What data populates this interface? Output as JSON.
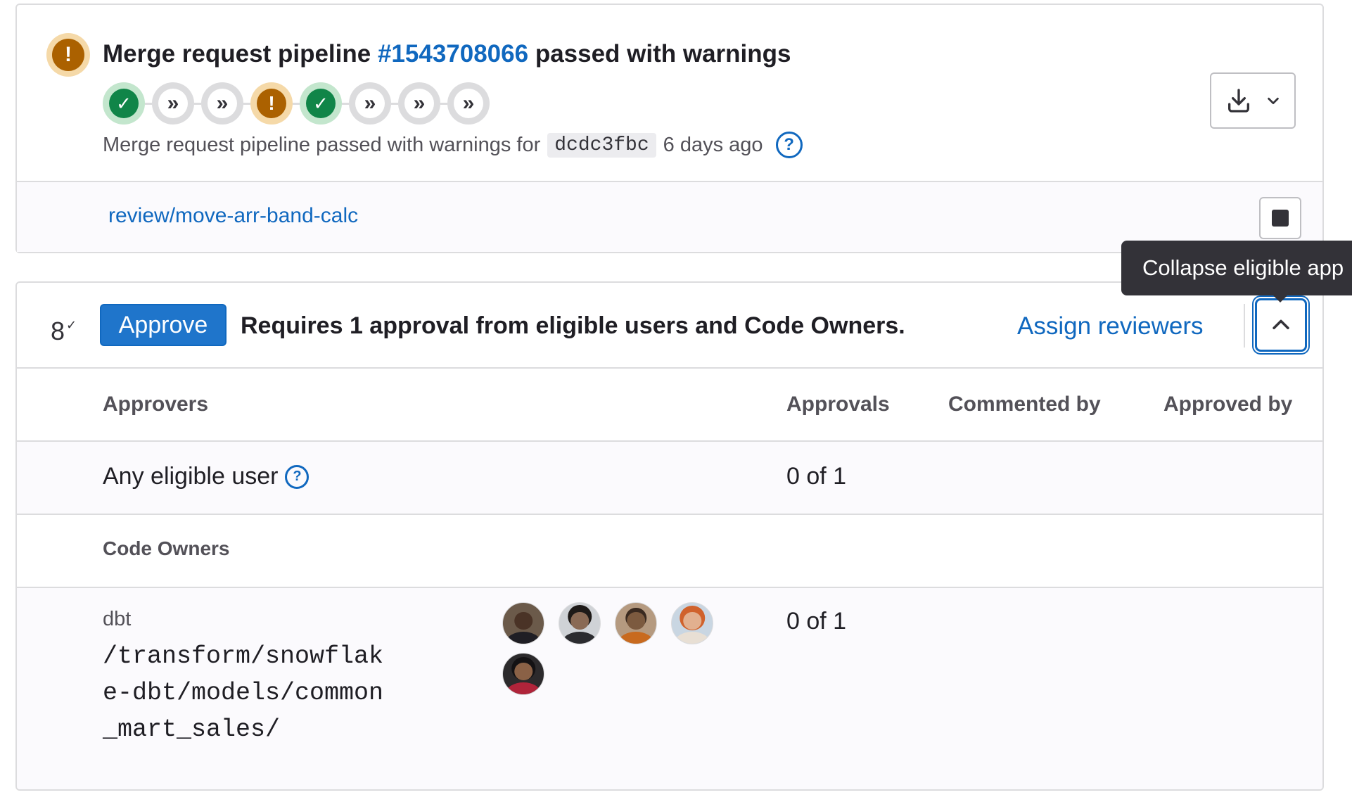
{
  "pipeline": {
    "title_prefix": "Merge request pipeline",
    "pipeline_id": "#1543708066",
    "title_suffix": "passed with warnings",
    "status_icon": "warning-icon",
    "stages": [
      {
        "status": "success",
        "icon": "check-icon"
      },
      {
        "status": "skipped",
        "icon": "skipped-icon"
      },
      {
        "status": "skipped",
        "icon": "skipped-icon"
      },
      {
        "status": "warning",
        "icon": "warning-icon"
      },
      {
        "status": "success",
        "icon": "check-icon"
      },
      {
        "status": "skipped",
        "icon": "skipped-icon"
      },
      {
        "status": "skipped",
        "icon": "skipped-icon"
      },
      {
        "status": "skipped",
        "icon": "skipped-icon"
      }
    ],
    "subtitle_prefix": "Merge request pipeline passed with warnings for",
    "commit_sha": "dcdc3fbc",
    "time_ago": "6 days ago",
    "environment_link": "review/move-arr-band-calc"
  },
  "approvals": {
    "count": "8",
    "approve_label": "Approve",
    "requirement_text": "Requires 1 approval from eligible users and Code Owners.",
    "assign_reviewers_label": "Assign reviewers",
    "tooltip": "Collapse eligible app",
    "columns": {
      "approvers": "Approvers",
      "approvals": "Approvals",
      "commented_by": "Commented by",
      "approved_by": "Approved by"
    },
    "any_eligible": {
      "label": "Any eligible user",
      "approvals": "0 of 1"
    },
    "code_owners_heading": "Code Owners",
    "dbt_rule": {
      "name": "dbt",
      "path": "/transform/snowflake-dbt/models/common_mart_sales/",
      "approvals": "0 of 1"
    }
  },
  "colors": {
    "link": "#1068bf",
    "success": "#108548",
    "warning": "#ab6100",
    "approve_button": "#1f75cb"
  }
}
